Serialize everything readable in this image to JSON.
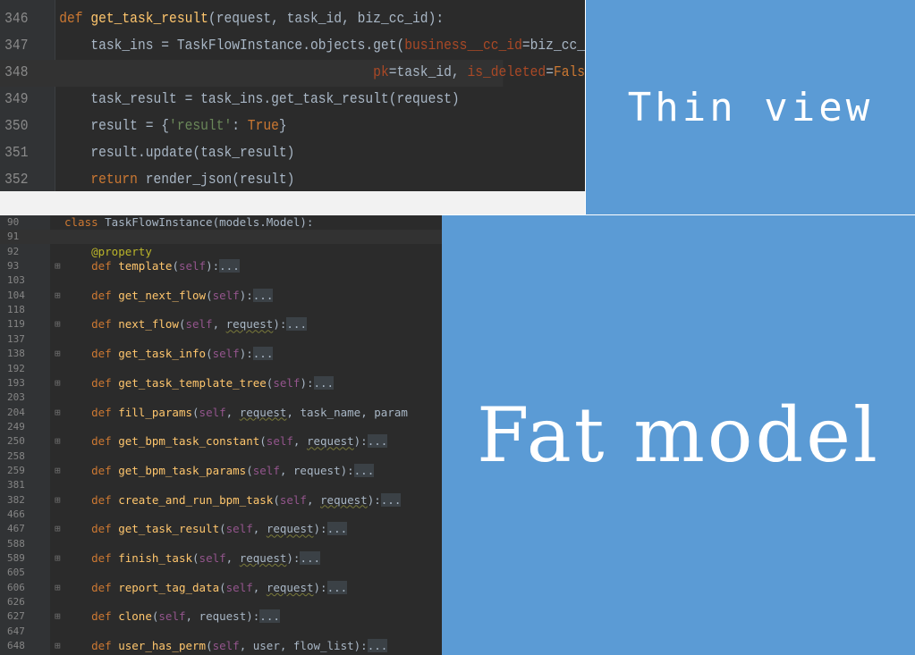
{
  "top_editor": {
    "lines": [
      {
        "num": "346",
        "parts": [
          {
            "t": "def ",
            "c": "kw"
          },
          {
            "t": "get_task_result",
            "c": "fn"
          },
          {
            "t": "(request, task_id, biz_cc_id):",
            "c": ""
          }
        ]
      },
      {
        "num": "347",
        "parts": [
          {
            "t": "    task_ins = TaskFlowInstance.objects.get(",
            "c": ""
          },
          {
            "t": "business__cc_id",
            "c": "param"
          },
          {
            "t": "=biz_cc_id,",
            "c": ""
          }
        ]
      },
      {
        "num": "348",
        "parts": [
          {
            "t": "                                        ",
            "c": ""
          },
          {
            "t": "pk",
            "c": "param"
          },
          {
            "t": "=task_id, ",
            "c": ""
          },
          {
            "t": "is_deleted",
            "c": "param"
          },
          {
            "t": "=",
            "c": ""
          },
          {
            "t": "False",
            "c": "kw"
          },
          {
            "t": ")",
            "c": ""
          }
        ]
      },
      {
        "num": "349",
        "parts": [
          {
            "t": "    task_result = task_ins.get_task_result(request)",
            "c": ""
          }
        ]
      },
      {
        "num": "350",
        "parts": [
          {
            "t": "    result = {",
            "c": ""
          },
          {
            "t": "'result'",
            "c": "str"
          },
          {
            "t": ": ",
            "c": ""
          },
          {
            "t": "True",
            "c": "kw"
          },
          {
            "t": "}",
            "c": ""
          }
        ]
      },
      {
        "num": "351",
        "parts": [
          {
            "t": "    result.update(task_result)",
            "c": ""
          }
        ]
      },
      {
        "num": "352",
        "parts": [
          {
            "t": "    ",
            "c": ""
          },
          {
            "t": "return ",
            "c": "kw"
          },
          {
            "t": "render_json(result)",
            "c": ""
          }
        ]
      }
    ]
  },
  "thin_panel": {
    "label": "Thin view",
    "color": "#5b9bd5"
  },
  "fat_panel": {
    "label": "Fat model",
    "color": "#5b9bd5"
  },
  "bottom_editor": {
    "lines": [
      {
        "num": "90",
        "fold": "",
        "parts": [
          {
            "t": "class ",
            "c": "kw"
          },
          {
            "t": "TaskFlowInstance(models.Model):",
            "c": ""
          }
        ]
      },
      {
        "num": "91",
        "fold": "",
        "parts": []
      },
      {
        "num": "92",
        "fold": "",
        "parts": [
          {
            "t": "    ",
            "c": ""
          },
          {
            "t": "@property",
            "c": "deco"
          }
        ]
      },
      {
        "num": "93",
        "fold": "⊞",
        "parts": [
          {
            "t": "    ",
            "c": ""
          },
          {
            "t": "def ",
            "c": "kw"
          },
          {
            "t": "template",
            "c": "fn"
          },
          {
            "t": "(",
            "c": ""
          },
          {
            "t": "self",
            "c": "self"
          },
          {
            "t": "):",
            "c": ""
          },
          {
            "t": "...",
            "c": "fold-dots"
          }
        ]
      },
      {
        "num": "103",
        "fold": "",
        "parts": []
      },
      {
        "num": "104",
        "fold": "⊞",
        "parts": [
          {
            "t": "    ",
            "c": ""
          },
          {
            "t": "def ",
            "c": "kw"
          },
          {
            "t": "get_next_flow",
            "c": "fn"
          },
          {
            "t": "(",
            "c": ""
          },
          {
            "t": "self",
            "c": "self"
          },
          {
            "t": "):",
            "c": ""
          },
          {
            "t": "...",
            "c": "fold-dots"
          }
        ]
      },
      {
        "num": "118",
        "fold": "",
        "parts": []
      },
      {
        "num": "119",
        "fold": "⊞",
        "parts": [
          {
            "t": "    ",
            "c": ""
          },
          {
            "t": "def ",
            "c": "kw"
          },
          {
            "t": "next_flow",
            "c": "fn"
          },
          {
            "t": "(",
            "c": ""
          },
          {
            "t": "self",
            "c": "self"
          },
          {
            "t": ", ",
            "c": ""
          },
          {
            "t": "request",
            "c": "warn"
          },
          {
            "t": "):",
            "c": ""
          },
          {
            "t": "...",
            "c": "fold-dots"
          }
        ]
      },
      {
        "num": "137",
        "fold": "",
        "parts": []
      },
      {
        "num": "138",
        "fold": "⊞",
        "parts": [
          {
            "t": "    ",
            "c": ""
          },
          {
            "t": "def ",
            "c": "kw"
          },
          {
            "t": "get_task_info",
            "c": "fn"
          },
          {
            "t": "(",
            "c": ""
          },
          {
            "t": "self",
            "c": "self"
          },
          {
            "t": "):",
            "c": ""
          },
          {
            "t": "...",
            "c": "fold-dots"
          }
        ]
      },
      {
        "num": "192",
        "fold": "",
        "parts": []
      },
      {
        "num": "193",
        "fold": "⊞",
        "parts": [
          {
            "t": "    ",
            "c": ""
          },
          {
            "t": "def ",
            "c": "kw"
          },
          {
            "t": "get_task_template_tree",
            "c": "fn"
          },
          {
            "t": "(",
            "c": ""
          },
          {
            "t": "self",
            "c": "self"
          },
          {
            "t": "):",
            "c": ""
          },
          {
            "t": "...",
            "c": "fold-dots"
          }
        ]
      },
      {
        "num": "203",
        "fold": "",
        "parts": []
      },
      {
        "num": "204",
        "fold": "⊞",
        "parts": [
          {
            "t": "    ",
            "c": ""
          },
          {
            "t": "def ",
            "c": "kw"
          },
          {
            "t": "fill_params",
            "c": "fn"
          },
          {
            "t": "(",
            "c": ""
          },
          {
            "t": "self",
            "c": "self"
          },
          {
            "t": ", ",
            "c": ""
          },
          {
            "t": "request",
            "c": "warn"
          },
          {
            "t": ", task_name, param",
            "c": ""
          }
        ]
      },
      {
        "num": "249",
        "fold": "",
        "parts": []
      },
      {
        "num": "250",
        "fold": "⊞",
        "parts": [
          {
            "t": "    ",
            "c": ""
          },
          {
            "t": "def ",
            "c": "kw"
          },
          {
            "t": "get_bpm_task_constant",
            "c": "fn"
          },
          {
            "t": "(",
            "c": ""
          },
          {
            "t": "self",
            "c": "self"
          },
          {
            "t": ", ",
            "c": ""
          },
          {
            "t": "request",
            "c": "warn"
          },
          {
            "t": "):",
            "c": ""
          },
          {
            "t": "...",
            "c": "fold-dots"
          }
        ]
      },
      {
        "num": "258",
        "fold": "",
        "parts": []
      },
      {
        "num": "259",
        "fold": "⊞",
        "parts": [
          {
            "t": "    ",
            "c": ""
          },
          {
            "t": "def ",
            "c": "kw"
          },
          {
            "t": "get_bpm_task_params",
            "c": "fn"
          },
          {
            "t": "(",
            "c": ""
          },
          {
            "t": "self",
            "c": "self"
          },
          {
            "t": ", request):",
            "c": ""
          },
          {
            "t": "...",
            "c": "fold-dots"
          }
        ]
      },
      {
        "num": "381",
        "fold": "",
        "parts": []
      },
      {
        "num": "382",
        "fold": "⊞",
        "parts": [
          {
            "t": "    ",
            "c": ""
          },
          {
            "t": "def ",
            "c": "kw"
          },
          {
            "t": "create_and_run_bpm_task",
            "c": "fn"
          },
          {
            "t": "(",
            "c": ""
          },
          {
            "t": "self",
            "c": "self"
          },
          {
            "t": ", ",
            "c": ""
          },
          {
            "t": "request",
            "c": "warn"
          },
          {
            "t": "):",
            "c": ""
          },
          {
            "t": "...",
            "c": "fold-dots"
          }
        ]
      },
      {
        "num": "466",
        "fold": "",
        "parts": []
      },
      {
        "num": "467",
        "fold": "⊞",
        "parts": [
          {
            "t": "    ",
            "c": ""
          },
          {
            "t": "def ",
            "c": "kw"
          },
          {
            "t": "get_task_result",
            "c": "fn"
          },
          {
            "t": "(",
            "c": ""
          },
          {
            "t": "self",
            "c": "self"
          },
          {
            "t": ", ",
            "c": ""
          },
          {
            "t": "request",
            "c": "warn"
          },
          {
            "t": "):",
            "c": ""
          },
          {
            "t": "...",
            "c": "fold-dots"
          }
        ]
      },
      {
        "num": "588",
        "fold": "",
        "parts": []
      },
      {
        "num": "589",
        "fold": "⊞",
        "parts": [
          {
            "t": "    ",
            "c": ""
          },
          {
            "t": "def ",
            "c": "kw"
          },
          {
            "t": "finish_task",
            "c": "fn"
          },
          {
            "t": "(",
            "c": ""
          },
          {
            "t": "self",
            "c": "self"
          },
          {
            "t": ", ",
            "c": ""
          },
          {
            "t": "request",
            "c": "warn"
          },
          {
            "t": "):",
            "c": ""
          },
          {
            "t": "...",
            "c": "fold-dots"
          }
        ]
      },
      {
        "num": "605",
        "fold": "",
        "parts": []
      },
      {
        "num": "606",
        "fold": "⊞",
        "parts": [
          {
            "t": "    ",
            "c": ""
          },
          {
            "t": "def ",
            "c": "kw"
          },
          {
            "t": "report_tag_data",
            "c": "fn"
          },
          {
            "t": "(",
            "c": ""
          },
          {
            "t": "self",
            "c": "self"
          },
          {
            "t": ", ",
            "c": ""
          },
          {
            "t": "request",
            "c": "warn"
          },
          {
            "t": "):",
            "c": ""
          },
          {
            "t": "...",
            "c": "fold-dots"
          }
        ]
      },
      {
        "num": "626",
        "fold": "",
        "parts": []
      },
      {
        "num": "627",
        "fold": "⊞",
        "parts": [
          {
            "t": "    ",
            "c": ""
          },
          {
            "t": "def ",
            "c": "kw"
          },
          {
            "t": "clone",
            "c": "fn"
          },
          {
            "t": "(",
            "c": ""
          },
          {
            "t": "self",
            "c": "self"
          },
          {
            "t": ", request):",
            "c": ""
          },
          {
            "t": "...",
            "c": "fold-dots"
          }
        ]
      },
      {
        "num": "647",
        "fold": "",
        "parts": []
      },
      {
        "num": "648",
        "fold": "⊞",
        "parts": [
          {
            "t": "    ",
            "c": ""
          },
          {
            "t": "def ",
            "c": "kw"
          },
          {
            "t": "user_has_perm",
            "c": "fn"
          },
          {
            "t": "(",
            "c": ""
          },
          {
            "t": "self",
            "c": "self"
          },
          {
            "t": ", user, flow_list):",
            "c": ""
          },
          {
            "t": "...",
            "c": "fold-dots"
          }
        ]
      }
    ]
  }
}
